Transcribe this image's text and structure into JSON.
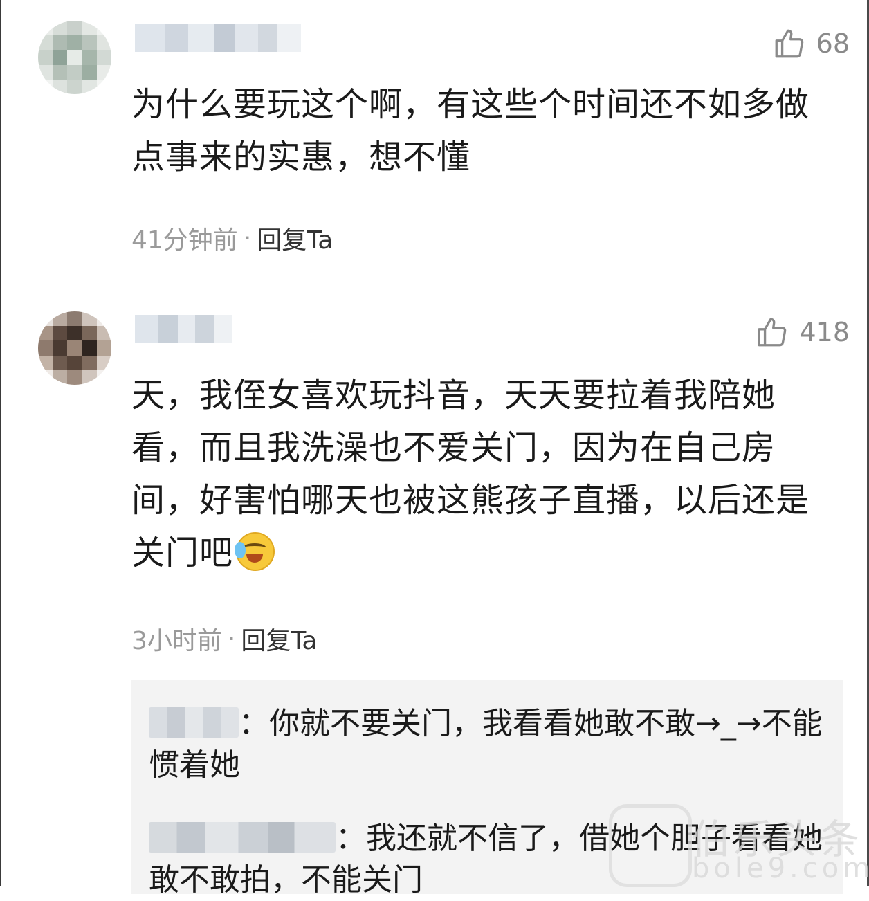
{
  "comments": [
    {
      "likes": "68",
      "text": "为什么要玩这个啊，有这些个时间还不如多做点事来的实惠，想不懂",
      "time": "41分钟前",
      "reply_label": "回复Ta"
    },
    {
      "likes": "418",
      "text": "天，我侄女喜欢玩抖音，天天要拉着我陪她看，而且我洗澡也不爱关门，因为在自己房间，好害怕哪天也被这熊孩子直播，以后还是关门吧",
      "time": "3小时前",
      "reply_label": "回复Ta",
      "replies": [
        {
          "text": "：你就不要关门，我看看她敢不敢→_→不能惯着她"
        },
        {
          "text": "：我还就不信了，借她个胆子看看她敢不敢拍，不能关门"
        }
      ]
    }
  ],
  "separator": "·",
  "watermark": {
    "brand": "伯乐头条",
    "url": "bole9.com"
  },
  "colors": {
    "like_gray": "#8a8a8a",
    "meta_gray": "#9a9a9a",
    "reply_bg": "#f3f3f3"
  },
  "icons": {
    "like": "thumbs-up-icon",
    "emoji": "crying-laughing-emoji"
  }
}
